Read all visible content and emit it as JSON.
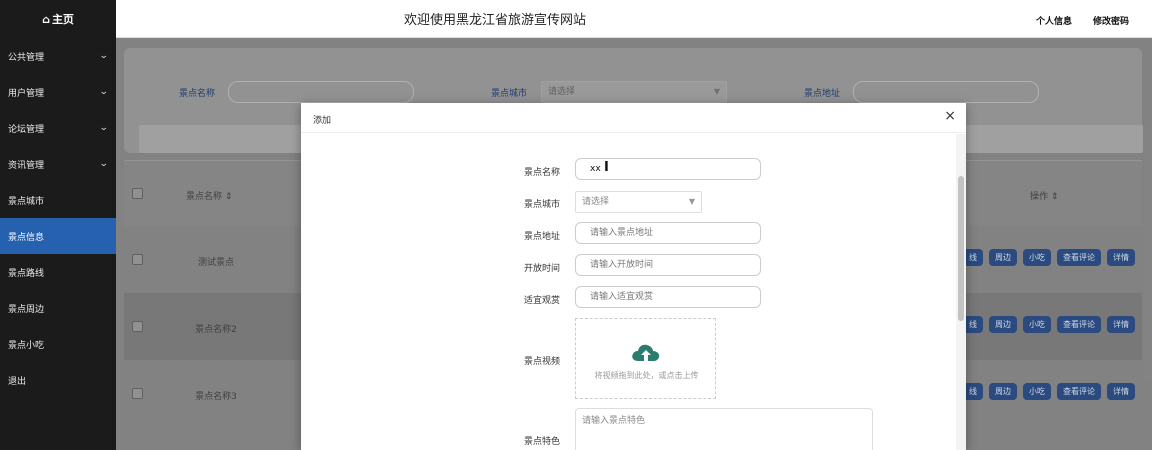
{
  "sidebar": {
    "home_label": "主页",
    "items": [
      {
        "label": "公共管理",
        "chevron": true
      },
      {
        "label": "用户管理",
        "chevron": true
      },
      {
        "label": "论坛管理",
        "chevron": true
      },
      {
        "label": "资讯管理",
        "chevron": true
      },
      {
        "label": "景点城市",
        "chevron": false
      },
      {
        "label": "景点信息",
        "chevron": false,
        "active": true
      },
      {
        "label": "景点路线",
        "chevron": false
      },
      {
        "label": "景点周边",
        "chevron": false
      },
      {
        "label": "景点小吃",
        "chevron": false
      },
      {
        "label": "退出",
        "chevron": false
      }
    ]
  },
  "header": {
    "title": "欢迎使用黑龙江省旅游宣传网站",
    "profile_link": "个人信息",
    "password_link": "修改密码"
  },
  "search": {
    "name_label": "景点名称",
    "city_label": "景点城市",
    "city_placeholder": "请选择",
    "address_label": "景点地址"
  },
  "table": {
    "col_name": "景点名称",
    "col_actions": "操作",
    "rows": [
      {
        "name": "测试景点"
      },
      {
        "name": "景点名称2"
      },
      {
        "name": "景点名称3"
      }
    ],
    "row_actions": [
      "线",
      "周边",
      "小吃",
      "查看评论",
      "详情"
    ]
  },
  "modal": {
    "title": "添加",
    "close_glyph": "×",
    "fields": {
      "name_label": "景点名称",
      "name_value": "xx",
      "city_label": "景点城市",
      "city_placeholder": "请选择",
      "address_label": "景点地址",
      "address_placeholder": "请输入景点地址",
      "open_time_label": "开放时间",
      "open_time_placeholder": "请输入开放时间",
      "season_label": "适宜观赏",
      "season_placeholder": "请输入适宜观赏",
      "video_label": "景点视频",
      "video_upload_tip": "将视频拖到此处，或点击上传",
      "feature_label": "景点特色",
      "feature_placeholder": "请输入景点特色"
    }
  },
  "colors": {
    "sidebar_bg": "#1b1b1b",
    "sidebar_active": "#2661b0",
    "action_button": "#2d4e87",
    "upload_icon": "#2a7d6c"
  },
  "icons": {
    "home": "home-icon",
    "chevron": "chevron-down-icon",
    "sort": "sort-icon",
    "close": "close-icon",
    "upload": "cloud-upload-icon"
  }
}
